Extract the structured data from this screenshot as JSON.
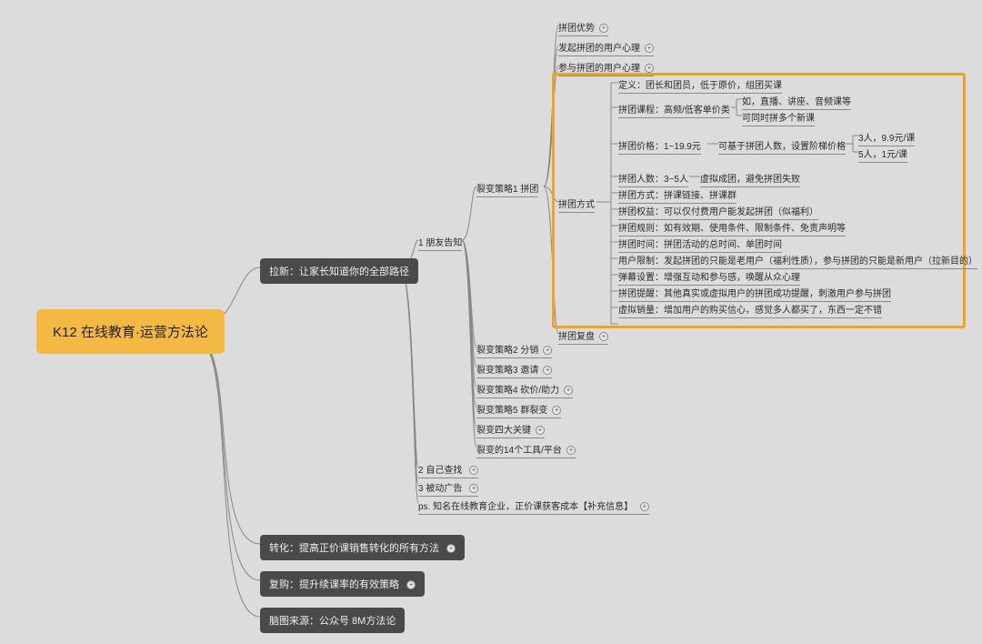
{
  "root": "K12 在线教育·运营方法论",
  "level1": {
    "laxin": "拉新：让家长知道你的全部路径",
    "zhuanhua": "转化：提高正价课销售转化的所有方法",
    "fugou": "复购：提升续课率的有效策略",
    "source": "脑图来源：公众号 8M方法论"
  },
  "level2": {
    "friend": "1 朋友告知",
    "self": "2 自己查找",
    "passive": "3 被动广告",
    "ps": "ps. 知名在线教育企业，正价课获客成本【补充信息】"
  },
  "strategies": {
    "s1": "裂变策略1 拼团",
    "s2": "裂变策略2 分销",
    "s3": "裂变策略3 邀请",
    "s4": "裂变策略4 砍价/助力",
    "s5": "裂变策略5 群裂变",
    "keys": "裂变四大关键",
    "tools": "裂变的14个工具/平台"
  },
  "pintuan": {
    "adv": "拼团优势",
    "initiator": "发起拼团的用户心理",
    "participant": "参与拼团的用户心理",
    "method": "拼团方式",
    "review": "拼团复盘"
  },
  "details": {
    "def": "定义：团长和团员，低于原价，组团买课",
    "course": "拼团课程：高频/低客单价类",
    "course_eg": "如，直播、讲座、音频课等",
    "course_multi": "可同时拼多个新课",
    "price": "拼团价格：1~19.9元",
    "price_rule": "可基于拼团人数，设置阶梯价格",
    "price_3": "3人，9.9元/课",
    "price_5": "5人，1元/课",
    "people": "拼团人数：3~5人",
    "people_virtual": "虚拟成团，避免拼团失败",
    "way": "拼团方式：拼课链接、拼课群",
    "rights": "拼团权益：可以仅付费用户能发起拼团（似福利）",
    "rules": "拼团规则：如有效期、使用条件、限制条件、免责声明等",
    "time": "拼团时间：拼团活动的总时间、单团时间",
    "userlimit": "用户限制：发起拼团的只能是老用户（福利性质），参与拼团的只能是新用户（拉新目的）",
    "danmu": "弹幕设置：增强互动和参与感，唤醒从众心理",
    "remind": "拼团提醒：其他真实或虚拟用户的拼团成功提醒，刺激用户参与拼团",
    "virtual_sale": "虚拟销量：增加用户的购买信心，感觉多人都买了，东西一定不错"
  }
}
